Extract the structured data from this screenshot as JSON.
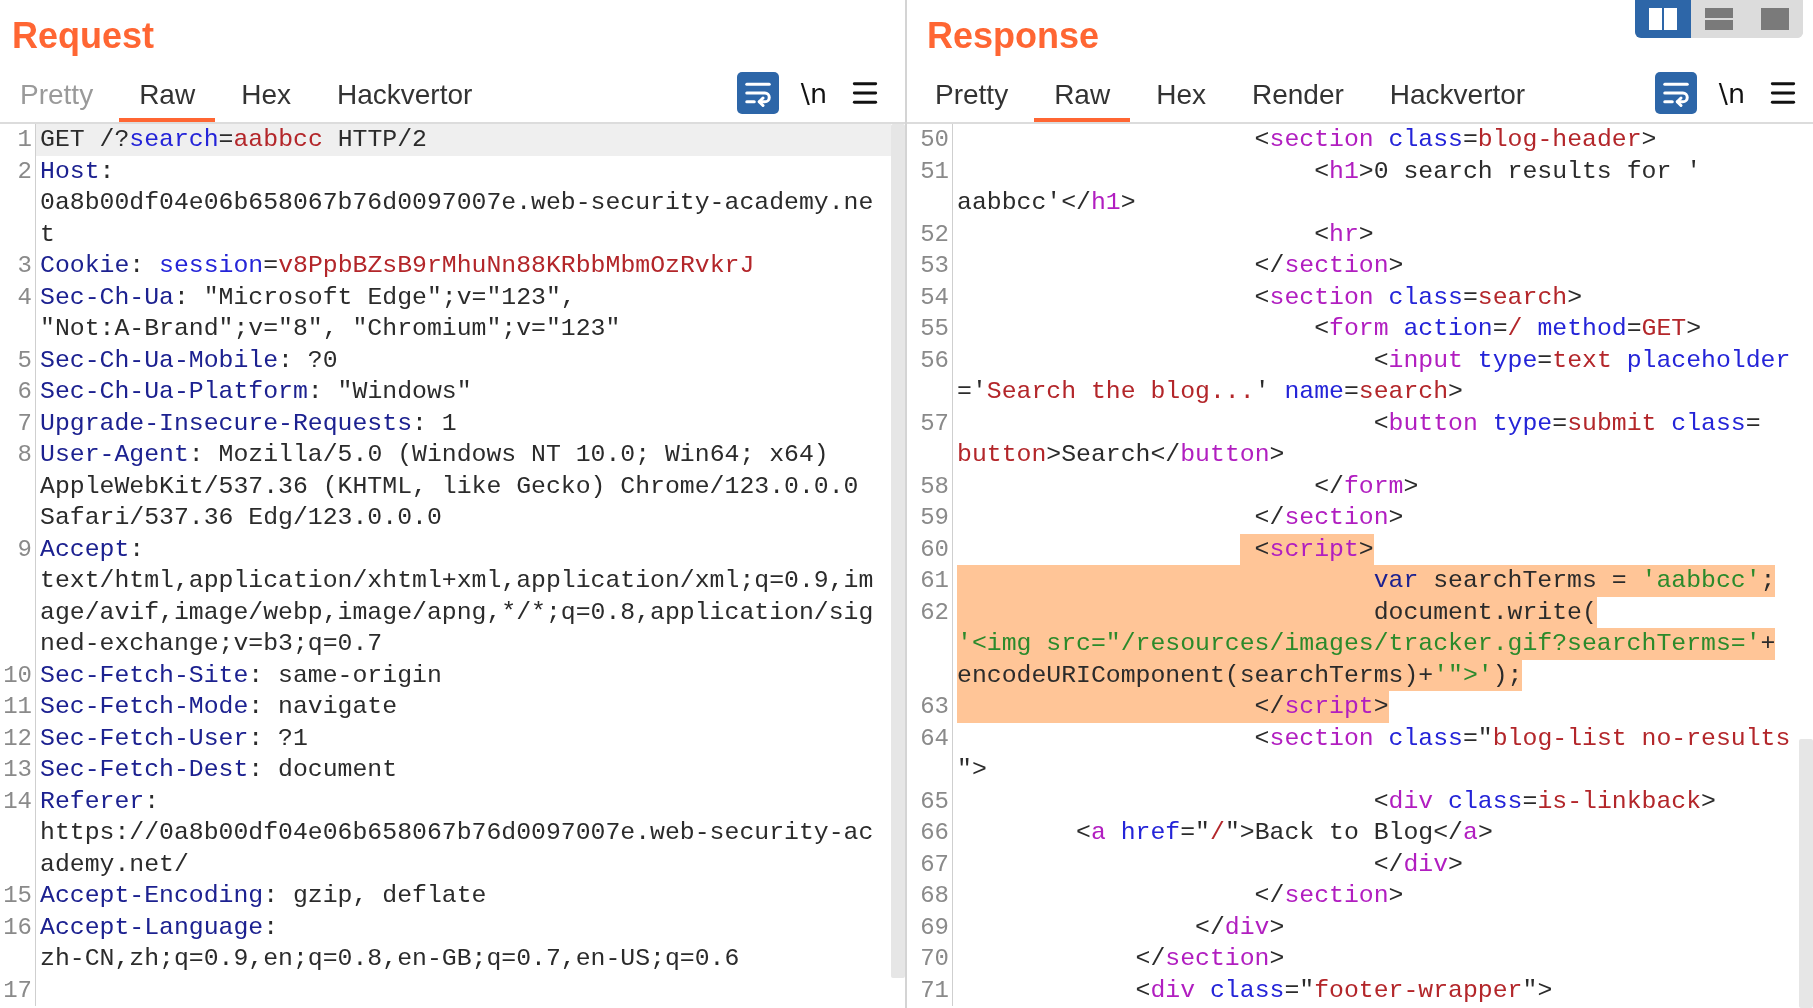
{
  "request": {
    "title": "Request",
    "tabs": [
      {
        "label": "Pretty",
        "selected": false,
        "disabled": true
      },
      {
        "label": "Raw",
        "selected": true,
        "disabled": false
      },
      {
        "label": "Hex",
        "selected": false,
        "disabled": false
      },
      {
        "label": "Hackvertor",
        "selected": false,
        "disabled": false
      }
    ],
    "toolbar": {
      "newline_label": "\\n"
    },
    "rows": [
      {
        "n": "1",
        "current": true,
        "tokens": [
          {
            "kind": "plain",
            "text": "GET /?"
          },
          {
            "kind": "param",
            "text": "search"
          },
          {
            "kind": "plain",
            "text": "="
          },
          {
            "kind": "value",
            "text": "aabbcc"
          },
          {
            "kind": "plain",
            "text": " HTTP/2"
          }
        ]
      },
      {
        "n": "2",
        "current": false,
        "tokens": [
          {
            "kind": "header",
            "text": "Host"
          },
          {
            "kind": "plain",
            "text": ":"
          }
        ]
      },
      {
        "current": false,
        "tokens": [
          {
            "kind": "plain",
            "text": "0a8b00df04e06b658067b76d0097007e.web-security-academy.ne"
          }
        ]
      },
      {
        "current": false,
        "tokens": [
          {
            "kind": "plain",
            "text": "t"
          }
        ]
      },
      {
        "n": "3",
        "current": false,
        "tokens": [
          {
            "kind": "header",
            "text": "Cookie"
          },
          {
            "kind": "plain",
            "text": ": "
          },
          {
            "kind": "param",
            "text": "session"
          },
          {
            "kind": "plain",
            "text": "="
          },
          {
            "kind": "value",
            "text": "v8PpbBZsB9rMhuNn88KRbbMbmOzRvkrJ"
          }
        ]
      },
      {
        "n": "4",
        "current": false,
        "tokens": [
          {
            "kind": "header",
            "text": "Sec-Ch-Ua"
          },
          {
            "kind": "plain",
            "text": ": \"Microsoft Edge\";v=\"123\","
          }
        ]
      },
      {
        "current": false,
        "tokens": [
          {
            "kind": "plain",
            "text": "\"Not:A-Brand\";v=\"8\", \"Chromium\";v=\"123\""
          }
        ]
      },
      {
        "n": "5",
        "current": false,
        "tokens": [
          {
            "kind": "header",
            "text": "Sec-Ch-Ua-Mobile"
          },
          {
            "kind": "plain",
            "text": ": ?0"
          }
        ]
      },
      {
        "n": "6",
        "current": false,
        "tokens": [
          {
            "kind": "header",
            "text": "Sec-Ch-Ua-Platform"
          },
          {
            "kind": "plain",
            "text": ": \"Windows\""
          }
        ]
      },
      {
        "n": "7",
        "current": false,
        "tokens": [
          {
            "kind": "header",
            "text": "Upgrade-Insecure-Requests"
          },
          {
            "kind": "plain",
            "text": ": 1"
          }
        ]
      },
      {
        "n": "8",
        "current": false,
        "tokens": [
          {
            "kind": "header",
            "text": "User-Agent"
          },
          {
            "kind": "plain",
            "text": ": Mozilla/5.0 (Windows NT 10.0; Win64; x64)"
          }
        ]
      },
      {
        "current": false,
        "tokens": [
          {
            "kind": "plain",
            "text": "AppleWebKit/537.36 (KHTML, like Gecko) Chrome/123.0.0.0"
          }
        ]
      },
      {
        "current": false,
        "tokens": [
          {
            "kind": "plain",
            "text": "Safari/537.36 Edg/123.0.0.0"
          }
        ]
      },
      {
        "n": "9",
        "current": false,
        "tokens": [
          {
            "kind": "header",
            "text": "Accept"
          },
          {
            "kind": "plain",
            "text": ":"
          }
        ]
      },
      {
        "current": false,
        "tokens": [
          {
            "kind": "plain",
            "text": "text/html,application/xhtml+xml,application/xml;q=0.9,im"
          }
        ]
      },
      {
        "current": false,
        "tokens": [
          {
            "kind": "plain",
            "text": "age/avif,image/webp,image/apng,*/*;q=0.8,application/sig"
          }
        ]
      },
      {
        "current": false,
        "tokens": [
          {
            "kind": "plain",
            "text": "ned-exchange;v=b3;q=0.7"
          }
        ]
      },
      {
        "n": "10",
        "current": false,
        "tokens": [
          {
            "kind": "header",
            "text": "Sec-Fetch-Site"
          },
          {
            "kind": "plain",
            "text": ": same-origin"
          }
        ]
      },
      {
        "n": "11",
        "current": false,
        "tokens": [
          {
            "kind": "header",
            "text": "Sec-Fetch-Mode"
          },
          {
            "kind": "plain",
            "text": ": navigate"
          }
        ]
      },
      {
        "n": "12",
        "current": false,
        "tokens": [
          {
            "kind": "header",
            "text": "Sec-Fetch-User"
          },
          {
            "kind": "plain",
            "text": ": ?1"
          }
        ]
      },
      {
        "n": "13",
        "current": false,
        "tokens": [
          {
            "kind": "header",
            "text": "Sec-Fetch-Dest"
          },
          {
            "kind": "plain",
            "text": ": document"
          }
        ]
      },
      {
        "n": "14",
        "current": false,
        "tokens": [
          {
            "kind": "header",
            "text": "Referer"
          },
          {
            "kind": "plain",
            "text": ":"
          }
        ]
      },
      {
        "current": false,
        "tokens": [
          {
            "kind": "plain",
            "text": "https://0a8b00df04e06b658067b76d0097007e.web-security-ac"
          }
        ]
      },
      {
        "current": false,
        "tokens": [
          {
            "kind": "plain",
            "text": "ademy.net/"
          }
        ]
      },
      {
        "n": "15",
        "current": false,
        "tokens": [
          {
            "kind": "header",
            "text": "Accept-Encoding"
          },
          {
            "kind": "plain",
            "text": ": gzip, deflate"
          }
        ]
      },
      {
        "n": "16",
        "current": false,
        "tokens": [
          {
            "kind": "header",
            "text": "Accept-Language"
          },
          {
            "kind": "plain",
            "text": ":"
          }
        ]
      },
      {
        "current": false,
        "tokens": [
          {
            "kind": "plain",
            "text": "zh-CN,zh;q=0.9,en;q=0.8,en-GB;q=0.7,en-US;q=0.6"
          }
        ]
      },
      {
        "n": "17",
        "current": false
      }
    ]
  },
  "response": {
    "title": "Response",
    "view_modes": [
      {
        "kind": "columns",
        "selected": true
      },
      {
        "kind": "rows",
        "selected": false
      },
      {
        "kind": "single",
        "selected": false
      }
    ],
    "tabs": [
      {
        "label": "Pretty",
        "selected": false,
        "disabled": false
      },
      {
        "label": "Raw",
        "selected": true,
        "disabled": false
      },
      {
        "label": "Hex",
        "selected": false,
        "disabled": false
      },
      {
        "label": "Render",
        "selected": false,
        "disabled": false
      },
      {
        "label": "Hackvertor",
        "selected": false,
        "disabled": false
      }
    ],
    "toolbar": {
      "newline_label": "\\n"
    },
    "rows": [
      {
        "n": "50",
        "selected": false,
        "tokens": [
          {
            "kind": "plain",
            "text": "                    <"
          },
          {
            "kind": "tag",
            "text": "section"
          },
          {
            "kind": "attr",
            "text": " class"
          },
          {
            "kind": "plain",
            "text": "="
          },
          {
            "kind": "value",
            "text": "blog-header"
          },
          {
            "kind": "plain",
            "text": ">"
          }
        ]
      },
      {
        "n": "51",
        "selected": false,
        "tokens": [
          {
            "kind": "plain",
            "text": "                        <"
          },
          {
            "kind": "tag",
            "text": "h1"
          },
          {
            "kind": "plain",
            "text": ">0 search results for '"
          }
        ]
      },
      {
        "selected": false,
        "tokens": [
          {
            "kind": "plain",
            "text": "aabbcc'</"
          },
          {
            "kind": "tag",
            "text": "h1"
          },
          {
            "kind": "plain",
            "text": ">"
          }
        ]
      },
      {
        "n": "52",
        "selected": false,
        "tokens": [
          {
            "kind": "plain",
            "text": "                        <"
          },
          {
            "kind": "tag",
            "text": "hr"
          },
          {
            "kind": "plain",
            "text": ">"
          }
        ]
      },
      {
        "n": "53",
        "selected": false,
        "tokens": [
          {
            "kind": "plain",
            "text": "                    </"
          },
          {
            "kind": "tag",
            "text": "section"
          },
          {
            "kind": "plain",
            "text": ">"
          }
        ]
      },
      {
        "n": "54",
        "selected": false,
        "tokens": [
          {
            "kind": "plain",
            "text": "                    <"
          },
          {
            "kind": "tag",
            "text": "section"
          },
          {
            "kind": "attr",
            "text": " class"
          },
          {
            "kind": "plain",
            "text": "="
          },
          {
            "kind": "value",
            "text": "search"
          },
          {
            "kind": "plain",
            "text": ">"
          }
        ]
      },
      {
        "n": "55",
        "selected": false,
        "tokens": [
          {
            "kind": "plain",
            "text": "                        <"
          },
          {
            "kind": "tag",
            "text": "form"
          },
          {
            "kind": "attr",
            "text": " action"
          },
          {
            "kind": "plain",
            "text": "="
          },
          {
            "kind": "value",
            "text": "/"
          },
          {
            "kind": "attr",
            "text": " method"
          },
          {
            "kind": "plain",
            "text": "="
          },
          {
            "kind": "value",
            "text": "GET"
          },
          {
            "kind": "plain",
            "text": ">"
          }
        ]
      },
      {
        "n": "56",
        "selected": false,
        "tokens": [
          {
            "kind": "plain",
            "text": "                            <"
          },
          {
            "kind": "tag",
            "text": "input"
          },
          {
            "kind": "attr",
            "text": " type"
          },
          {
            "kind": "plain",
            "text": "="
          },
          {
            "kind": "value",
            "text": "text"
          },
          {
            "kind": "attr",
            "text": " placeholder"
          }
        ]
      },
      {
        "selected": false,
        "tokens": [
          {
            "kind": "plain",
            "text": "='"
          },
          {
            "kind": "value",
            "text": "Search the blog..."
          },
          {
            "kind": "plain",
            "text": "'"
          },
          {
            "kind": "attr",
            "text": " name"
          },
          {
            "kind": "plain",
            "text": "="
          },
          {
            "kind": "value",
            "text": "search"
          },
          {
            "kind": "plain",
            "text": ">"
          }
        ]
      },
      {
        "n": "57",
        "selected": false,
        "tokens": [
          {
            "kind": "plain",
            "text": "                            <"
          },
          {
            "kind": "tag",
            "text": "button"
          },
          {
            "kind": "attr",
            "text": " type"
          },
          {
            "kind": "plain",
            "text": "="
          },
          {
            "kind": "value",
            "text": "submit"
          },
          {
            "kind": "attr",
            "text": " class"
          },
          {
            "kind": "plain",
            "text": "="
          }
        ]
      },
      {
        "selected": false,
        "tokens": [
          {
            "kind": "value",
            "text": "button"
          },
          {
            "kind": "plain",
            "text": ">Search</"
          },
          {
            "kind": "tag",
            "text": "button"
          },
          {
            "kind": "plain",
            "text": ">"
          }
        ]
      },
      {
        "n": "58",
        "selected": false,
        "tokens": [
          {
            "kind": "plain",
            "text": "                        </"
          },
          {
            "kind": "tag",
            "text": "form"
          },
          {
            "kind": "plain",
            "text": ">"
          }
        ]
      },
      {
        "n": "59",
        "selected": false,
        "tokens": [
          {
            "kind": "plain",
            "text": "                    </"
          },
          {
            "kind": "tag",
            "text": "section"
          },
          {
            "kind": "plain",
            "text": ">"
          }
        ]
      },
      {
        "n": "60",
        "selected": true,
        "tokens": [
          {
            "kind": "plain",
            "text": "                    <"
          },
          {
            "kind": "tag",
            "text": "script"
          },
          {
            "kind": "plain",
            "text": ">"
          }
        ]
      },
      {
        "n": "61",
        "selected": true,
        "tokens": [
          {
            "kind": "keyword",
            "text": "                            var"
          },
          {
            "kind": "plain",
            "text": " searchTerms = "
          },
          {
            "kind": "string",
            "text": "'aabbcc'"
          },
          {
            "kind": "plain",
            "text": ";"
          }
        ]
      },
      {
        "n": "62",
        "selected": true,
        "tokens": [
          {
            "kind": "plain",
            "text": "                            document.write("
          }
        ]
      },
      {
        "selected": true,
        "tokens": [
          {
            "kind": "string",
            "text": "'<img src=\"/resources/images/tracker.gif?searchTerms='"
          },
          {
            "kind": "plain",
            "text": "+"
          }
        ]
      },
      {
        "selected": true,
        "tokens": [
          {
            "kind": "plain",
            "text": "encodeURIComponent(searchTerms)+"
          },
          {
            "kind": "string",
            "text": "'\">'"
          },
          {
            "kind": "plain",
            "text": ");"
          }
        ]
      },
      {
        "n": "63",
        "selected": true,
        "tokens": [
          {
            "kind": "plain",
            "text": "                    </"
          },
          {
            "kind": "tag",
            "text": "script"
          },
          {
            "kind": "plain",
            "text": ">"
          }
        ]
      },
      {
        "n": "64",
        "selected": false,
        "tokens": [
          {
            "kind": "plain",
            "text": "                    <"
          },
          {
            "kind": "tag",
            "text": "section"
          },
          {
            "kind": "attr",
            "text": " class"
          },
          {
            "kind": "plain",
            "text": "=\""
          },
          {
            "kind": "value",
            "text": "blog-list no-results"
          }
        ]
      },
      {
        "selected": false,
        "tokens": [
          {
            "kind": "plain",
            "text": "\">"
          }
        ]
      },
      {
        "n": "65",
        "selected": false,
        "tokens": [
          {
            "kind": "plain",
            "text": "                            <"
          },
          {
            "kind": "tag",
            "text": "div"
          },
          {
            "kind": "attr",
            "text": " class"
          },
          {
            "kind": "plain",
            "text": "="
          },
          {
            "kind": "value",
            "text": "is-linkback"
          },
          {
            "kind": "plain",
            "text": ">"
          }
        ]
      },
      {
        "n": "66",
        "selected": false,
        "tokens": [
          {
            "kind": "plain",
            "text": "        <"
          },
          {
            "kind": "tag",
            "text": "a"
          },
          {
            "kind": "attr",
            "text": " href"
          },
          {
            "kind": "plain",
            "text": "=\""
          },
          {
            "kind": "value",
            "text": "/"
          },
          {
            "kind": "plain",
            "text": "\">Back to Blog</"
          },
          {
            "kind": "tag",
            "text": "a"
          },
          {
            "kind": "plain",
            "text": ">"
          }
        ]
      },
      {
        "n": "67",
        "selected": false,
        "tokens": [
          {
            "kind": "plain",
            "text": "                            </"
          },
          {
            "kind": "tag",
            "text": "div"
          },
          {
            "kind": "plain",
            "text": ">"
          }
        ]
      },
      {
        "n": "68",
        "selected": false,
        "tokens": [
          {
            "kind": "plain",
            "text": "                    </"
          },
          {
            "kind": "tag",
            "text": "section"
          },
          {
            "kind": "plain",
            "text": ">"
          }
        ]
      },
      {
        "n": "69",
        "selected": false,
        "tokens": [
          {
            "kind": "plain",
            "text": "                </"
          },
          {
            "kind": "tag",
            "text": "div"
          },
          {
            "kind": "plain",
            "text": ">"
          }
        ]
      },
      {
        "n": "70",
        "selected": false,
        "tokens": [
          {
            "kind": "plain",
            "text": "            </"
          },
          {
            "kind": "tag",
            "text": "section"
          },
          {
            "kind": "plain",
            "text": ">"
          }
        ]
      },
      {
        "n": "71",
        "selected": false,
        "tokens": [
          {
            "kind": "plain",
            "text": "            <"
          },
          {
            "kind": "tag",
            "text": "div"
          },
          {
            "kind": "attr",
            "text": " class"
          },
          {
            "kind": "plain",
            "text": "=\""
          },
          {
            "kind": "value",
            "text": "footer-wrapper"
          },
          {
            "kind": "plain",
            "text": "\">"
          }
        ]
      }
    ]
  }
}
